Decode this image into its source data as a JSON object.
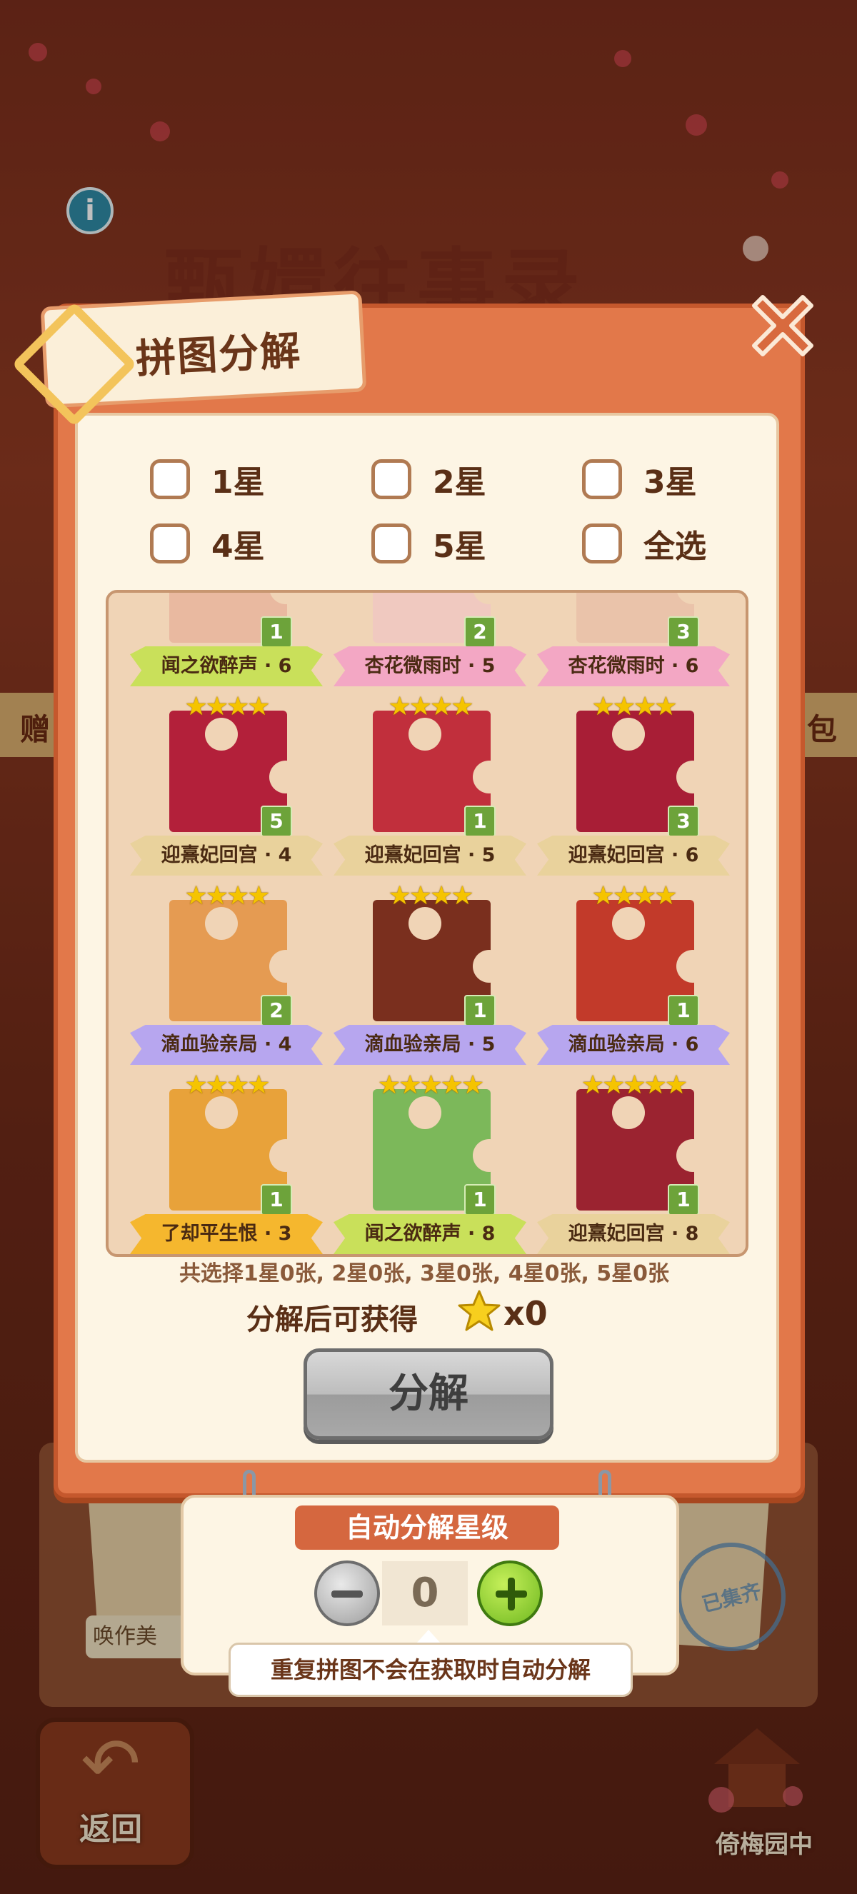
{
  "background": {
    "title": "甄嬛往事录",
    "banner_left": "赠",
    "banner_right": "包",
    "card_label": "唤作美",
    "stamp": "已集齐",
    "back_label": "返回",
    "garden_label": "倚梅园中"
  },
  "dialog": {
    "title": "拼图分解",
    "filters": [
      "1星",
      "2星",
      "3星",
      "4星",
      "5星",
      "全选"
    ],
    "summary": "共选择1星0张, 2星0张, 3星0张, 4星0张, 5星0张",
    "gain_label": "分解后可获得",
    "gain_value": "x0",
    "decompose_label": "分解"
  },
  "cards": [
    {
      "stars": "",
      "count": "1",
      "label": "闻之欲醉声 · 6",
      "ribbon": "#c9e05a",
      "art": "#e9b9a0"
    },
    {
      "stars": "",
      "count": "2",
      "label": "杏花微雨时 · 5",
      "ribbon": "#f3a7c4",
      "art": "#f0c9c0"
    },
    {
      "stars": "",
      "count": "3",
      "label": "杏花微雨时 · 6",
      "ribbon": "#f3a7c4",
      "art": "#eac3aa"
    },
    {
      "stars": "★★★★",
      "count": "5",
      "label": "迎熹妃回宫 · 4",
      "ribbon": "#e9d29c",
      "art": "#b3203a"
    },
    {
      "stars": "★★★★",
      "count": "1",
      "label": "迎熹妃回宫 · 5",
      "ribbon": "#e9d29c",
      "art": "#c12f3c"
    },
    {
      "stars": "★★★★",
      "count": "3",
      "label": "迎熹妃回宫 · 6",
      "ribbon": "#e9d29c",
      "art": "#a81e36"
    },
    {
      "stars": "★★★★",
      "count": "2",
      "label": "滴血验亲局 · 4",
      "ribbon": "#b7a6ef",
      "art": "#e59b52"
    },
    {
      "stars": "★★★★",
      "count": "1",
      "label": "滴血验亲局 · 5",
      "ribbon": "#b7a6ef",
      "art": "#7a2f1e"
    },
    {
      "stars": "★★★★",
      "count": "1",
      "label": "滴血验亲局 · 6",
      "ribbon": "#b7a6ef",
      "art": "#c23a2a"
    },
    {
      "stars": "★★★★",
      "count": "1",
      "label": "了却平生恨 · 3",
      "ribbon": "#f5b72e",
      "art": "#e8a23a"
    },
    {
      "stars": "★★★★★",
      "count": "1",
      "label": "闻之欲醉声 · 8",
      "ribbon": "#c9e05a",
      "art": "#7cb85a"
    },
    {
      "stars": "★★★★★",
      "count": "1",
      "label": "迎熹妃回宫 · 8",
      "ribbon": "#e9d29c",
      "art": "#9b2330"
    }
  ],
  "auto": {
    "header": "自动分解星级",
    "value": "0",
    "tip": "重复拼图不会在获取时自动分解"
  },
  "icons": {
    "close": "close-icon",
    "info": "info-icon",
    "star": "star-icon",
    "back": "back-arrow-icon"
  }
}
